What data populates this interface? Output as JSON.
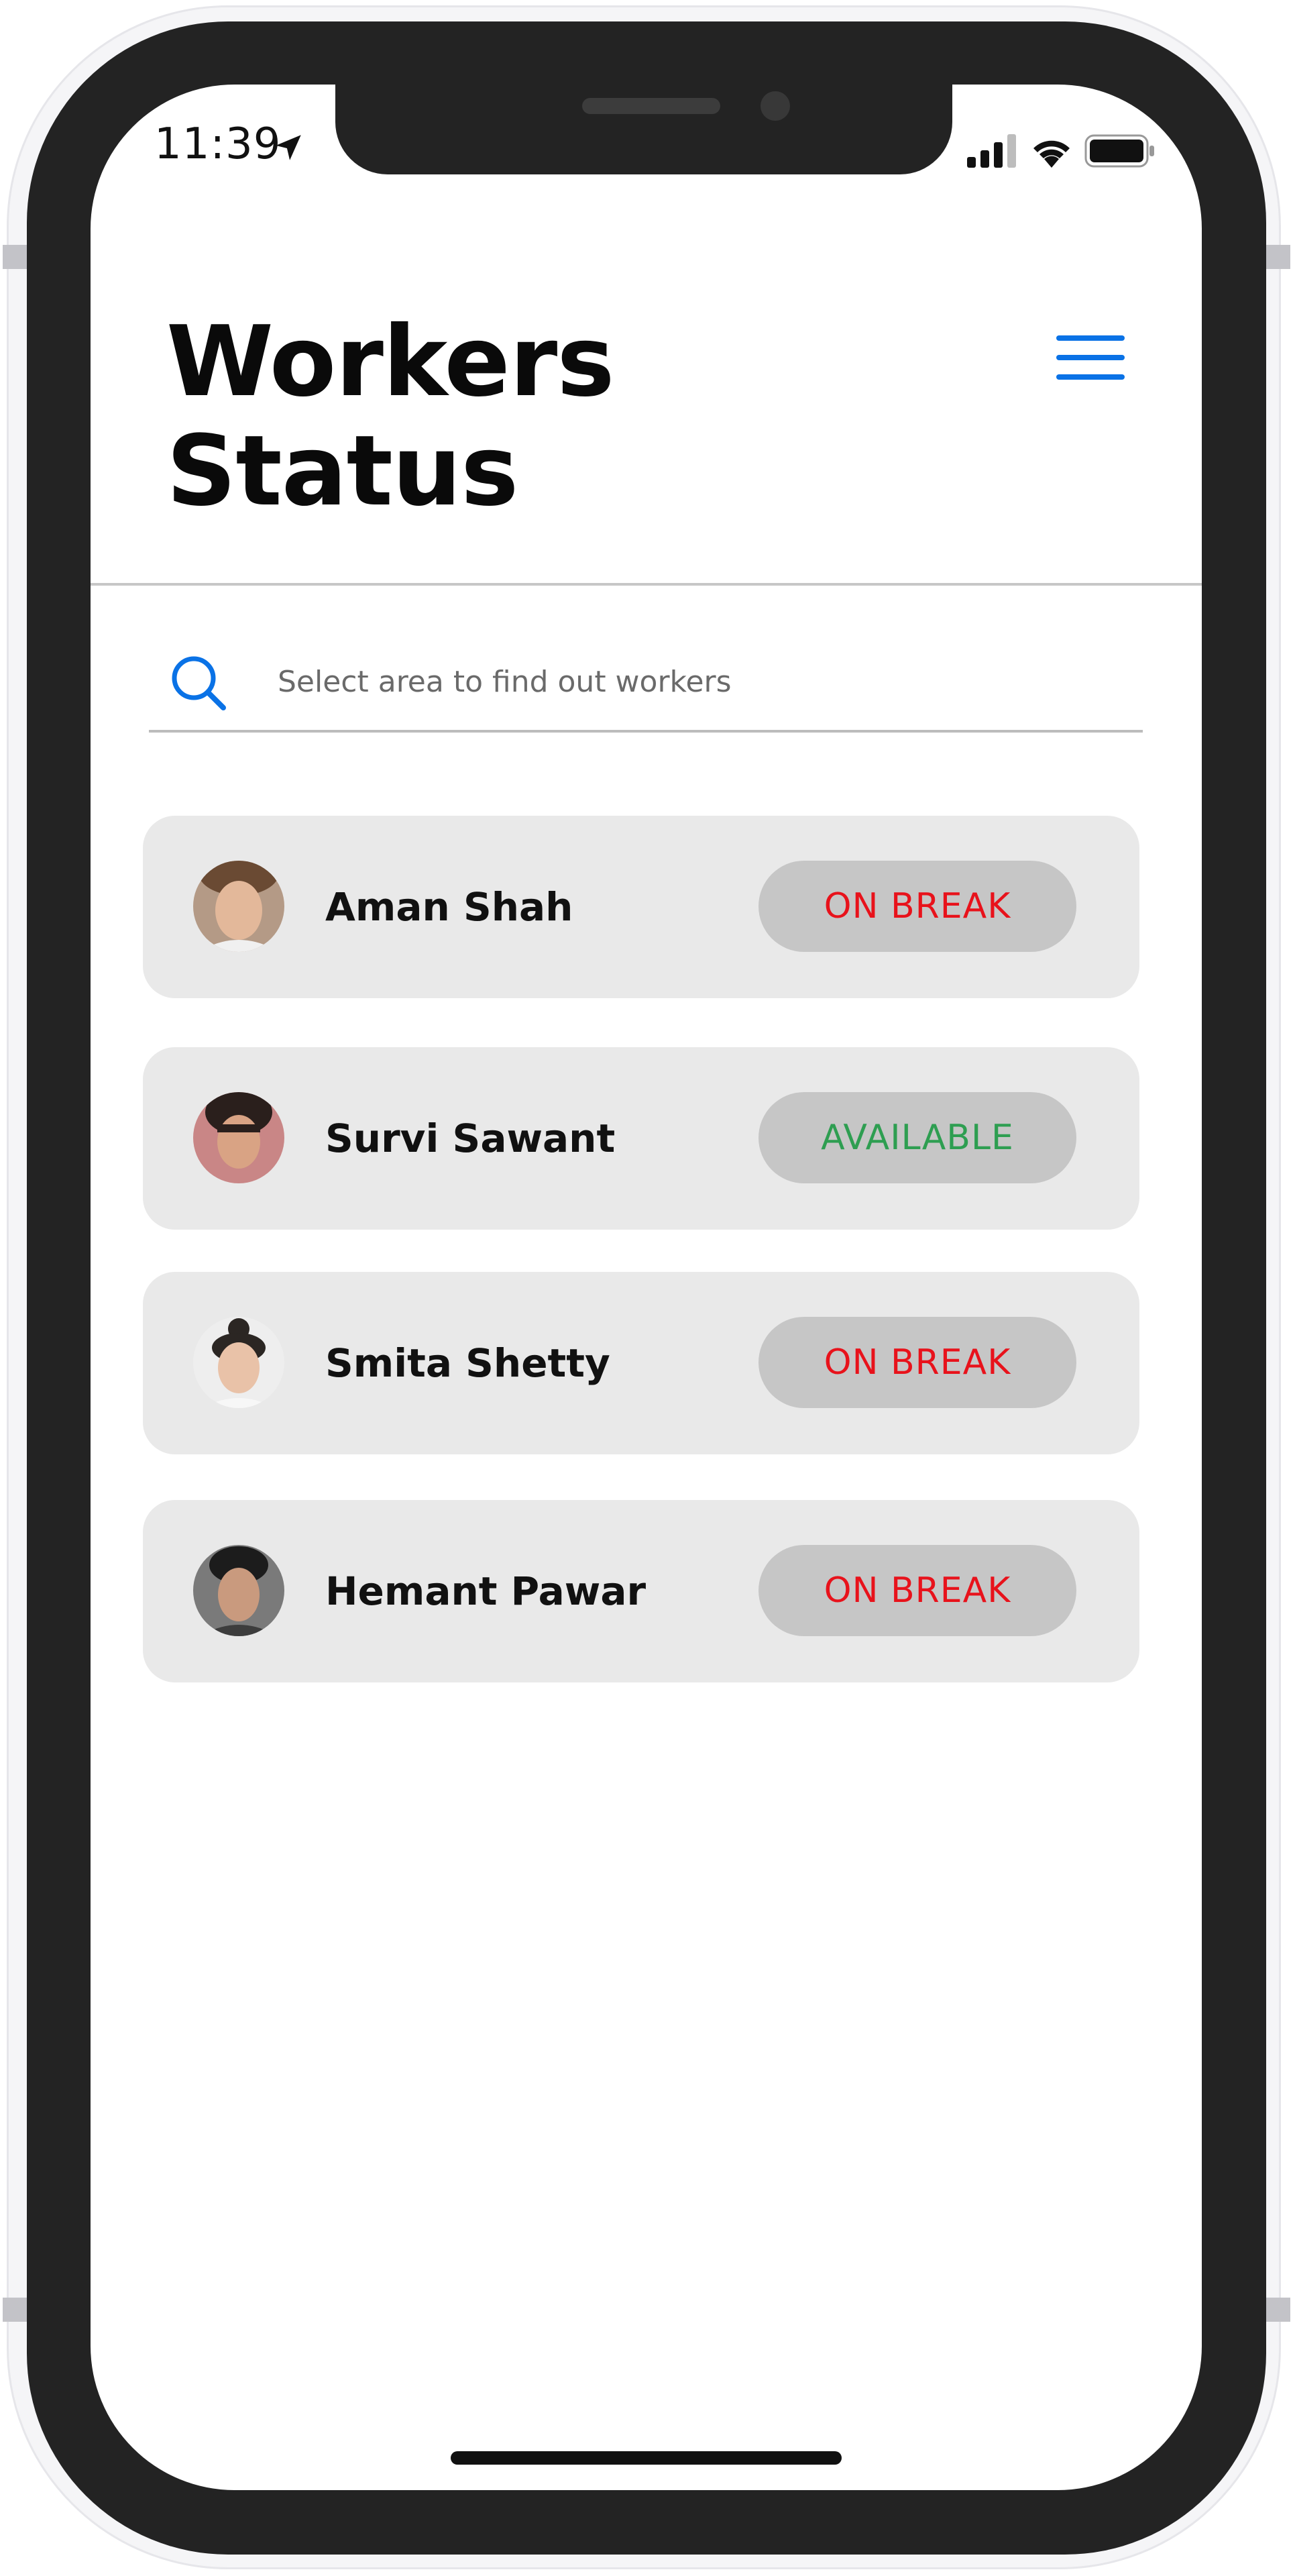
{
  "status_bar": {
    "time": "11:39"
  },
  "header": {
    "title_line1": "Workers",
    "title_line2": "Status"
  },
  "search": {
    "placeholder": "Select area to find out workers"
  },
  "workers": [
    {
      "name": "Aman Shah",
      "status": "ON BREAK"
    },
    {
      "name": "Survi Sawant",
      "status": "AVAILABLE"
    },
    {
      "name": "Smita Shetty",
      "status": "ON BREAK"
    },
    {
      "name": "Hemant Pawar",
      "status": "ON BREAK"
    }
  ],
  "colors": {
    "accent": "#0a72e6",
    "on_break": "#e8121b",
    "available": "#2e9e51",
    "card_bg": "#e9e9e9",
    "pill_bg": "#c6c6c6"
  },
  "icons": [
    "location-arrow-icon",
    "cellular-signal-icon",
    "wifi-icon",
    "battery-icon",
    "hamburger-menu-icon",
    "search-icon"
  ]
}
